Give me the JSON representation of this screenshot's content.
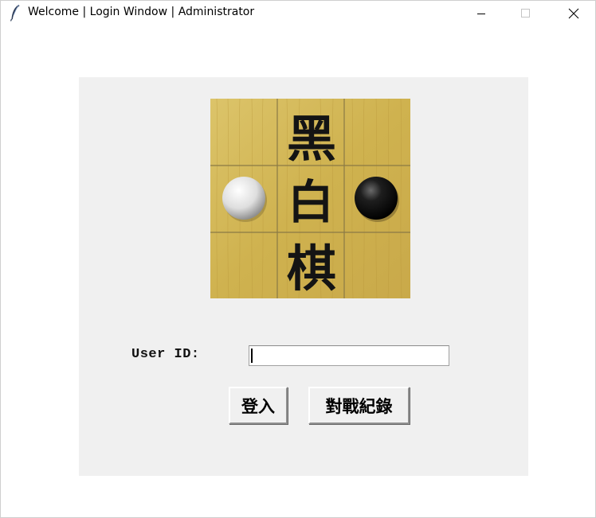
{
  "window": {
    "title": "Welcome | Login Window | Administrator",
    "icon": "feather-icon",
    "controls": [
      "minimize-icon",
      "maximize-icon",
      "close-icon"
    ]
  },
  "logo": {
    "characters": [
      "黑",
      "白",
      "棋"
    ],
    "board_color": "#d4b85a",
    "stones": [
      "white",
      "black"
    ]
  },
  "form": {
    "user_id_label": "User ID:",
    "user_id_value": ""
  },
  "buttons": {
    "login_label": "登入",
    "history_label": "對戰紀錄"
  },
  "colors": {
    "panel_background": "#f0f0f0",
    "window_background": "#ffffff"
  }
}
